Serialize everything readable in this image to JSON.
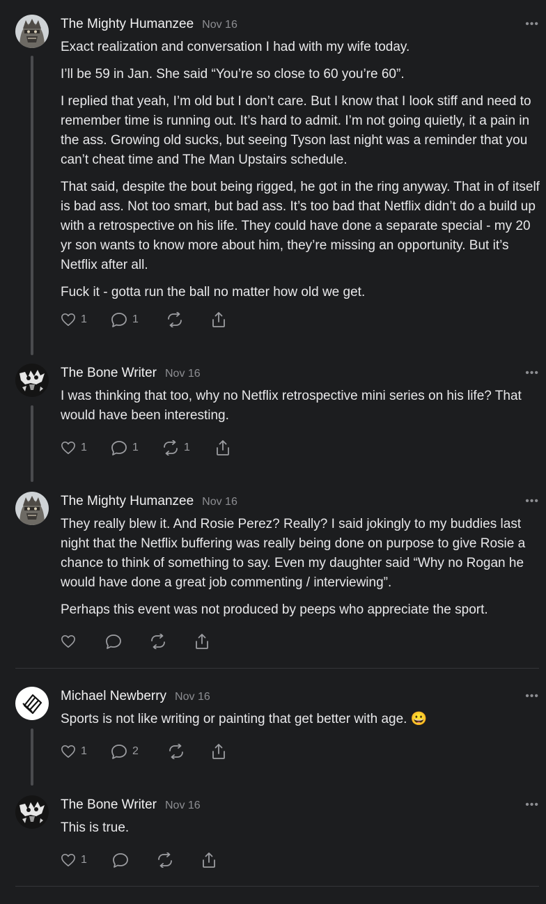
{
  "comments": [
    {
      "author": "The Mighty Humanzee",
      "date": "Nov 16",
      "avatar": "mask-avatar",
      "paragraphs": [
        "Exact realization and conversation I had with my wife today.",
        "I’ll be 59 in Jan. She said “You’re so close to 60 you’re 60”.",
        "I replied that yeah, I’m old but I don’t care. But I know that I look stiff and need to remember time is running out. It’s hard to admit. I’m not going quietly, it a pain in the ass. Growing old sucks, but seeing Tyson last night was a reminder that you can’t cheat time and The Man Upstairs schedule.",
        "That said, despite the bout being rigged, he got in the ring anyway. That in of itself is bad ass. Not too smart, but bad ass. It’s too bad that Netflix didn’t do a build up with a retrospective on his life. They could have done a separate special - my 20 yr son wants to know more about him, they’re missing an opportunity. But it’s Netflix after all.",
        "Fuck it - gotta run the ball no matter how old we get."
      ],
      "likes": "1",
      "replies": "1",
      "restacks": ""
    },
    {
      "author": "The Bone Writer",
      "date": "Nov 16",
      "avatar": "bw-avatar",
      "paragraphs": [
        "I was thinking that too, why no Netflix retrospective mini series on his life? That would have been interesting."
      ],
      "likes": "1",
      "replies": "1",
      "restacks": "1"
    },
    {
      "author": "The Mighty Humanzee",
      "date": "Nov 16",
      "avatar": "mask-avatar",
      "paragraphs": [
        "They really blew it. And Rosie Perez? Really? I said jokingly to my buddies last night that the Netflix buffering was really being done on purpose to give Rosie a chance to think of something to say. Even my daughter said “Why no Rogan he would have done a great job commenting / interviewing”.",
        "Perhaps this event was not produced by peeps who appreciate the sport."
      ],
      "likes": "",
      "replies": "",
      "restacks": ""
    },
    {
      "author": "Michael Newberry",
      "date": "Nov 16",
      "avatar": "logo-avatar",
      "paragraphs": [
        "Sports is not like writing or painting that get better with age. 😀"
      ],
      "likes": "1",
      "replies": "2",
      "restacks": ""
    },
    {
      "author": "The Bone Writer",
      "date": "Nov 16",
      "avatar": "bw-avatar",
      "paragraphs": [
        "This is true."
      ],
      "likes": "1",
      "replies": "",
      "restacks": ""
    }
  ],
  "more_label": "•••",
  "icons": {
    "like": "heart-icon",
    "reply": "speech-bubble-icon",
    "restack": "restack-icon",
    "share": "share-icon"
  },
  "colors": {
    "background": "#1c1d1f",
    "text": "#e8e8ea",
    "muted": "#8d8e92",
    "thread_line": "#4a4b4e"
  }
}
